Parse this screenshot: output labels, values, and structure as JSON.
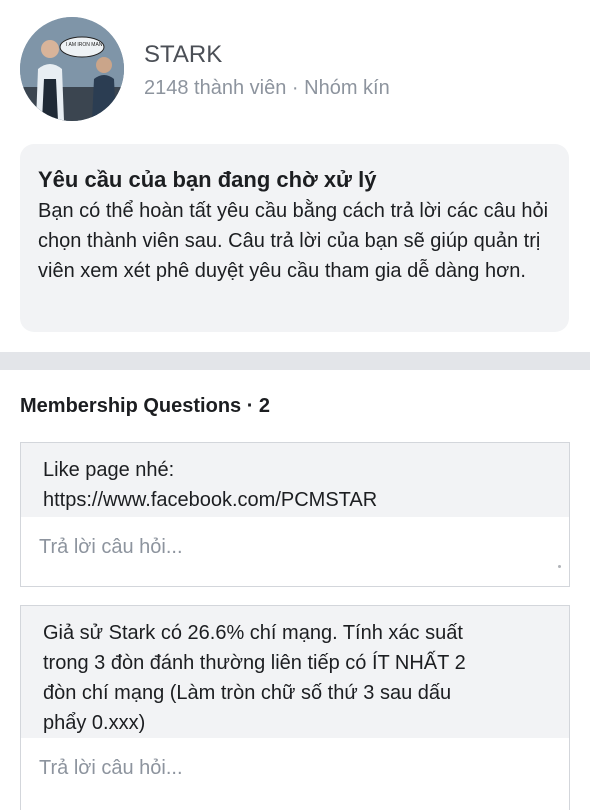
{
  "group": {
    "name": "STARK",
    "member_count": "2148 thành viên",
    "separator": "·",
    "privacy": "Nhóm kín",
    "avatar_caption": "I AM IRON MAN"
  },
  "pending": {
    "title": "Yêu cầu của bạn đang chờ xử lý",
    "body": "Bạn có thể hoàn tất yêu cầu bằng cách trả lời các câu hỏi chọn thành viên sau. Câu trả lời của bạn sẽ giúp quản trị viên xem xét phê duyệt yêu cầu tham gia dễ dàng hơn."
  },
  "membership": {
    "title": "Membership Questions · 2",
    "questions": [
      {
        "lines": [
          "Like page nhé:",
          "https://www.facebook.com/PCMSTAR"
        ],
        "answer_value": "",
        "answer_placeholder": "Trả lời câu hỏi..."
      },
      {
        "lines": [
          "Giả sử Stark có 26.6% chí mạng. Tính xác suất",
          "trong 3 đòn đánh thường liên tiếp có ÍT NHẤT 2",
          "đòn chí mạng (Làm tròn chữ số thứ 3 sau dấu",
          "phẩy 0.xxx)"
        ],
        "answer_value": "",
        "answer_placeholder": "Trả lời câu hỏi..."
      }
    ]
  },
  "colors": {
    "card_bg": "#f2f3f5",
    "divider": "#e3e5e9",
    "secondary_text": "#8d949e",
    "border": "#d3d6db"
  }
}
